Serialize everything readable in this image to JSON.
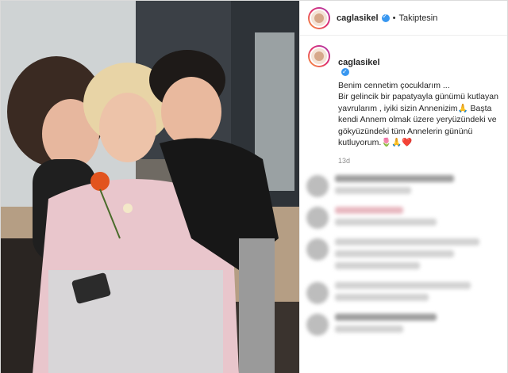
{
  "post": {
    "username": "caglasikel",
    "separator": "•",
    "follow_status": "Takiptesin",
    "caption_text": "Benim cennetim çocuklarım ...\nBir gelincik bir papatyayla günümü kutlayan yavrularım , iyiki sizin Annenizim🙏 Başta kendi Annem olmak üzere yeryüzündeki ve gökyüzündeki tüm Annelerin gününü kutluyorum.🌷🙏❤️",
    "time_ago": "13d"
  },
  "icons": {
    "verified": "verified-badge-icon"
  },
  "colors": {
    "accent": "#3897f0",
    "border": "#dbdbdb",
    "muted": "#8e8e8e"
  }
}
